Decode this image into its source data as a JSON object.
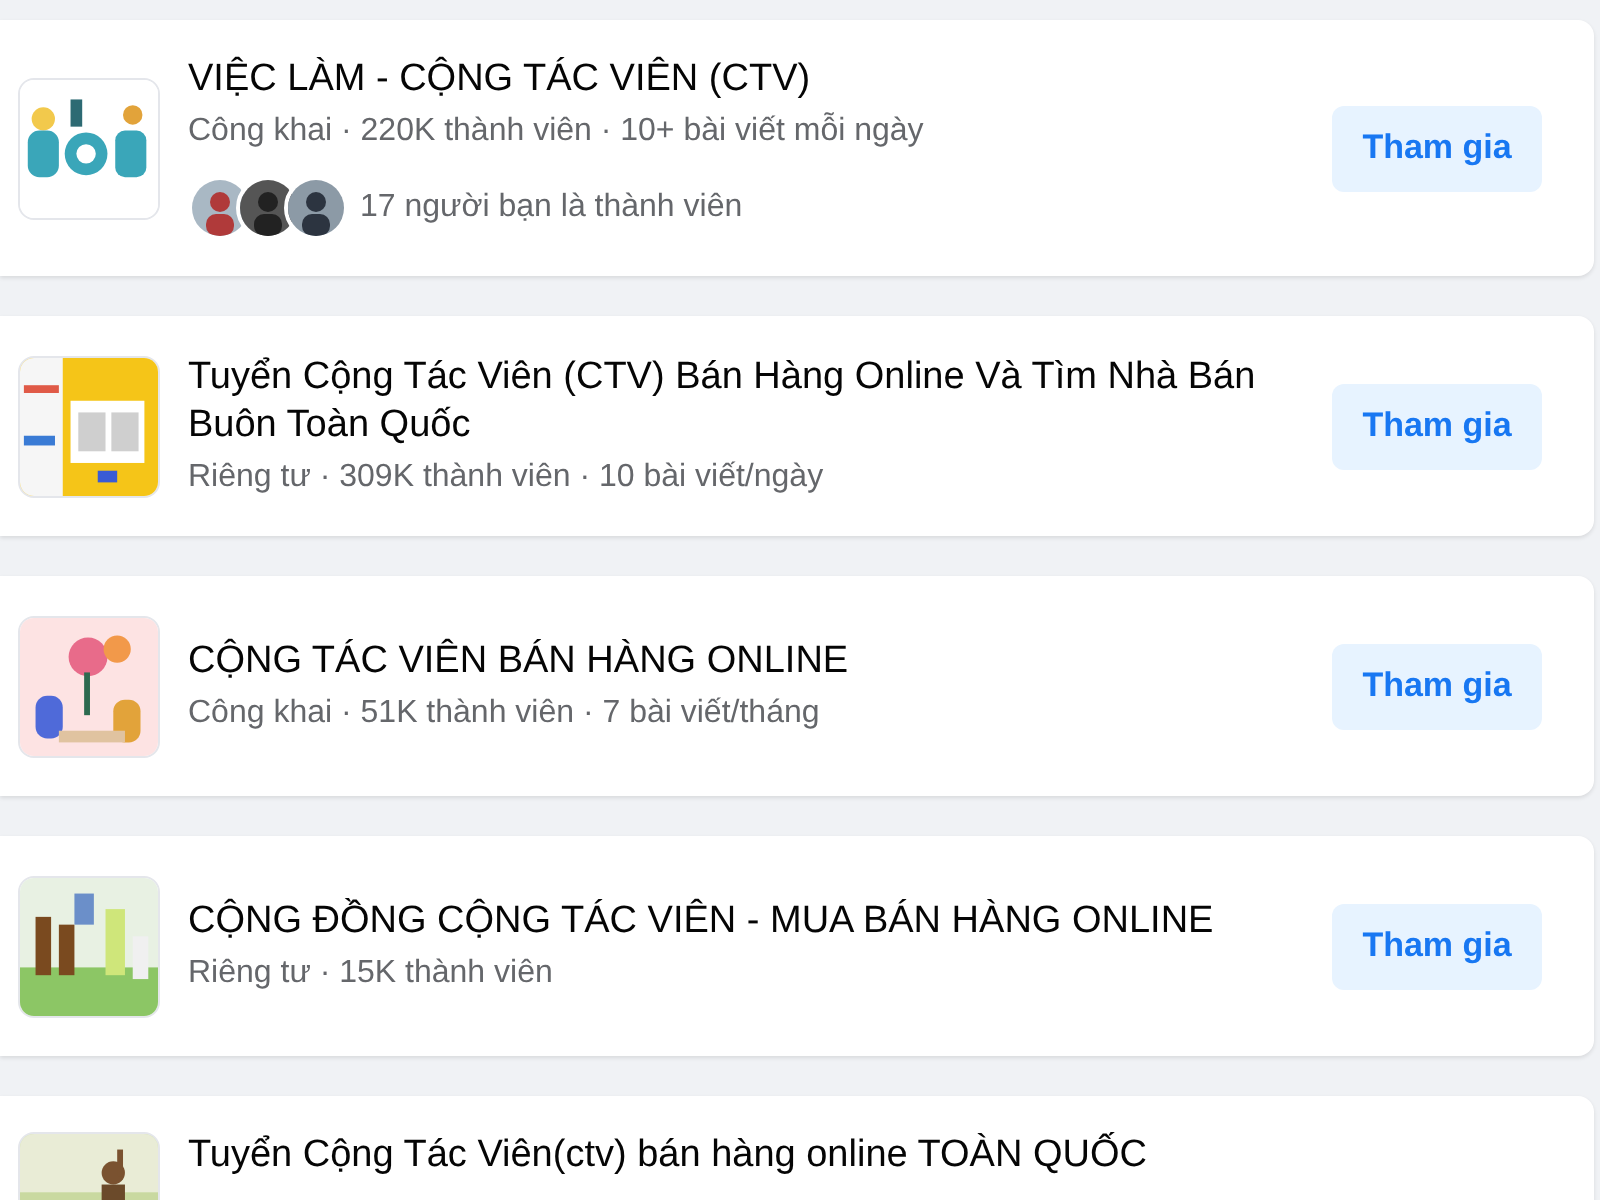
{
  "groups": [
    {
      "title": "VIỆC LÀM - CỘNG TÁC VIÊN (CTV)",
      "meta": "Công khai · 220K thành viên · 10+ bài viết mỗi ngày",
      "friends": {
        "count_text": "17 người bạn là thành viên"
      },
      "button": "Tham gia"
    },
    {
      "title": "Tuyển Cộng Tác Viên (CTV) Bán Hàng Online Và Tìm Nhà Bán Buôn Toàn Quốc",
      "meta": "Riêng tư · 309K thành viên · 10 bài viết/ngày",
      "button": "Tham gia"
    },
    {
      "title": "CỘNG TÁC VIÊN BÁN HÀNG ONLINE",
      "meta": "Công khai · 51K thành viên · 7 bài viết/tháng",
      "button": "Tham gia"
    },
    {
      "title": "CỘNG ĐỒNG CỘNG TÁC VIÊN - MUA BÁN HÀNG ONLINE",
      "meta": "Riêng tư · 15K thành viên",
      "button": "Tham gia"
    },
    {
      "title": "Tuyển Cộng Tác Viên(ctv) bán hàng online TOÀN QUỐC"
    }
  ]
}
